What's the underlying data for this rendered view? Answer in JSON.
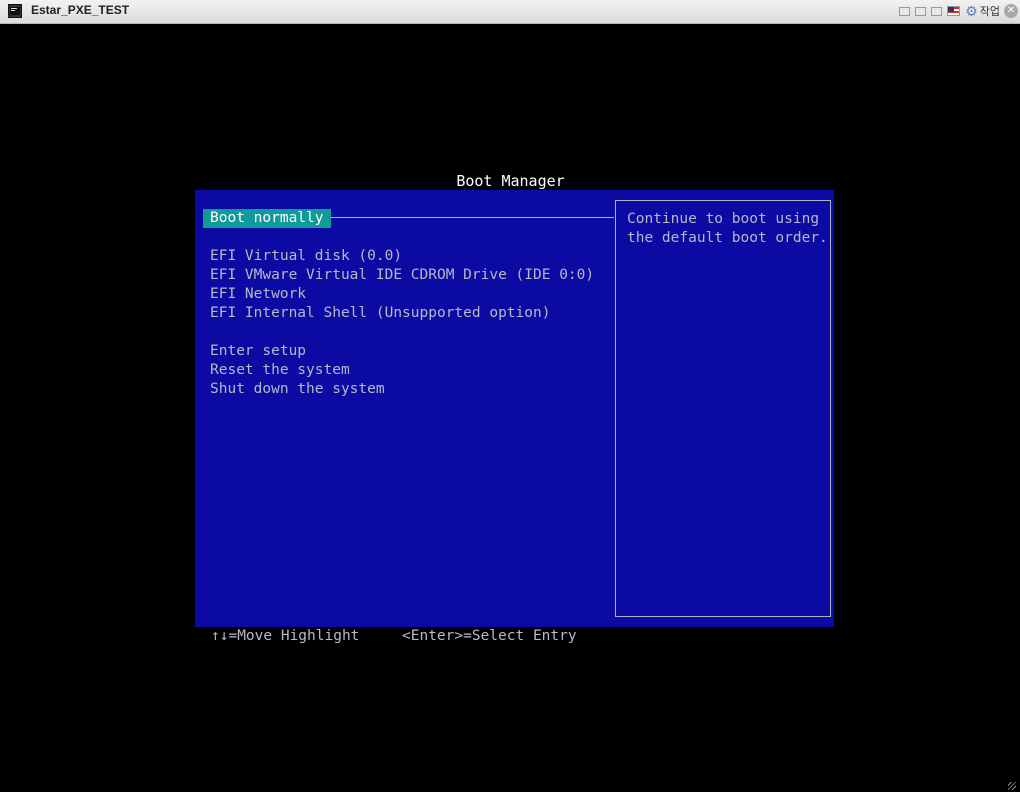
{
  "window": {
    "title": "Estar_PXE_TEST",
    "job_label": "작업"
  },
  "boot_manager": {
    "title": "Boot Manager",
    "selected_item": "Boot normally",
    "items_group1": [
      "EFI Virtual disk (0.0)",
      "EFI VMware Virtual IDE CDROM Drive (IDE 0:0)",
      "EFI Network",
      "EFI Internal Shell (Unsupported option)"
    ],
    "items_group2": [
      "Enter setup",
      "Reset the system",
      "Shut down the system"
    ],
    "help_text": "Continue to boot using\nthe default boot order.",
    "footer": {
      "move_hint": "↑↓=Move Highlight",
      "select_hint": "<Enter>=Select Entry"
    }
  },
  "colors": {
    "panel_bg": "#0b0ba4",
    "highlight_bg": "#119a9a",
    "text": "#b8b8c8"
  }
}
